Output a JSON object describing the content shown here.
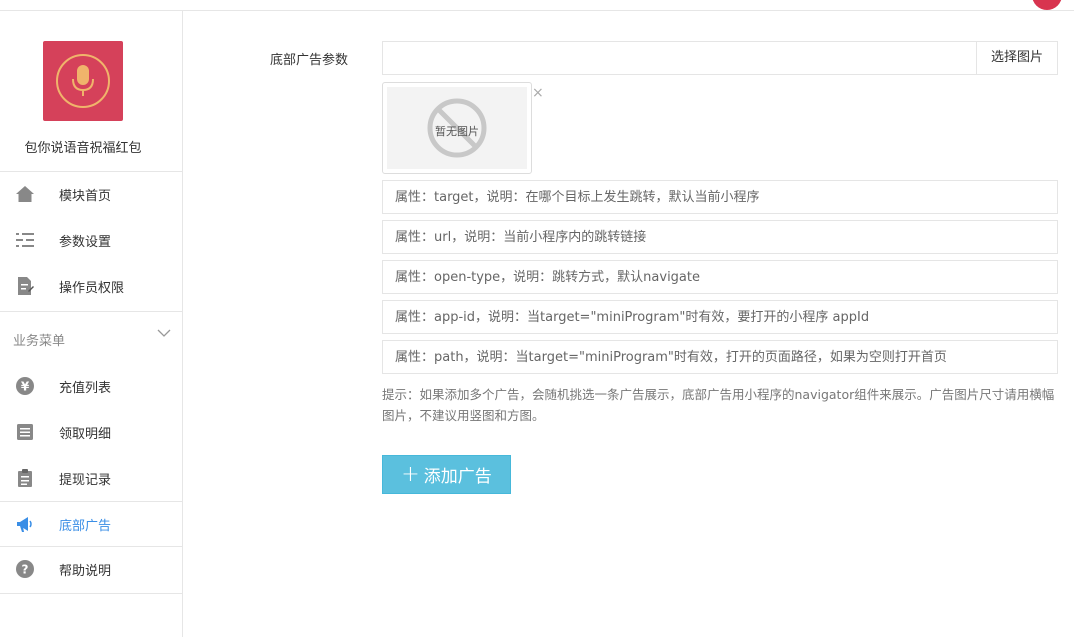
{
  "app": {
    "name": "包你说语音祝福红包"
  },
  "nav": {
    "top_items": [
      {
        "label": "模块首页",
        "icon": "home-icon"
      },
      {
        "label": "参数设置",
        "icon": "settings-list-icon"
      },
      {
        "label": "操作员权限",
        "icon": "edit-document-icon"
      }
    ],
    "group_title": "业务菜单",
    "group_items": [
      {
        "label": "充值列表",
        "icon": "yen-icon"
      },
      {
        "label": "领取明细",
        "icon": "list-icon"
      },
      {
        "label": "提现记录",
        "icon": "clipboard-icon"
      },
      {
        "label": "底部广告",
        "icon": "megaphone-icon",
        "active": true
      },
      {
        "label": "帮助说明",
        "icon": "help-icon"
      }
    ]
  },
  "form": {
    "field_label": "底部广告参数",
    "image_input_value": "",
    "choose_image_label": "选择图片",
    "no_image_text": "暂无图片",
    "remove_symbol": "×",
    "properties": [
      "属性：target，说明：在哪个目标上发生跳转，默认当前小程序",
      "属性：url，说明：当前小程序内的跳转链接",
      "属性：open-type，说明：跳转方式，默认navigate",
      "属性：app-id，说明：当target=\"miniProgram\"时有效，要打开的小程序 appId",
      "属性：path，说明：当target=\"miniProgram\"时有效，打开的页面路径，如果为空则打开首页"
    ],
    "hint": "提示：如果添加多个广告，会随机挑选一条广告展示，底部广告用小程序的navigator组件来展示。广告图片尺寸请用横幅图片，不建议用竖图和方图。",
    "add_button": {
      "symbol": "+",
      "label": "添加广告"
    }
  },
  "colors": {
    "accent": "#5bc0de",
    "active_nav": "#3a8ee6",
    "logo_bg": "#d5415a"
  }
}
